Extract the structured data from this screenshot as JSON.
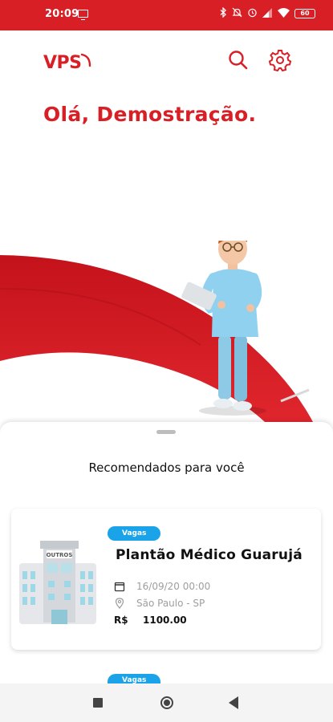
{
  "status_bar": {
    "time": "20:09",
    "battery": "60",
    "icons": [
      "screen-cast-icon",
      "bluetooth-icon",
      "notifications-off-icon",
      "alarm-icon",
      "signal-icon",
      "wifi-icon",
      "battery-icon"
    ]
  },
  "header": {
    "logo_text": "VPS",
    "search_icon": "search-icon",
    "settings_icon": "gear-icon"
  },
  "greeting": "Olá, Demostração.",
  "recommendations": {
    "title": "Recomendados para você",
    "cards": [
      {
        "badge": "Vagas",
        "image_label": "OUTROS",
        "title": "Plantão Médico Guarujá",
        "date": "16/09/20 00:00",
        "location": "São Paulo - SP",
        "currency": "R$",
        "price": "1100.00"
      },
      {
        "badge": "Vagas"
      }
    ]
  },
  "colors": {
    "brand_red": "#d81f26",
    "badge_blue": "#1aa3e8",
    "muted_text": "#9e9e9e"
  },
  "nav_bar": {
    "icons": [
      "recents-icon",
      "home-icon",
      "back-icon"
    ]
  }
}
